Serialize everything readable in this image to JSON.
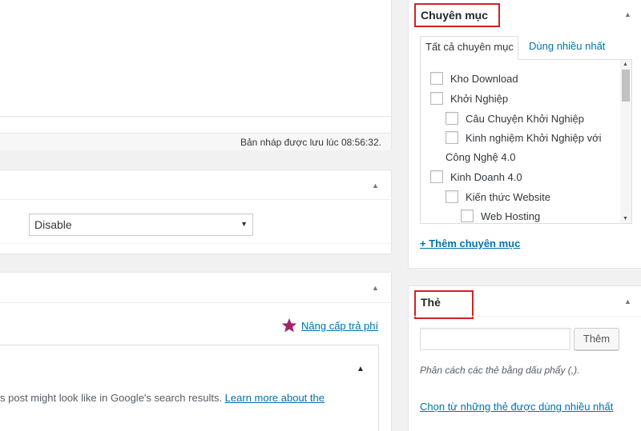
{
  "editor": {
    "status_text": "Bản nháp được lưu lúc 08:56:32."
  },
  "box2": {
    "select_value": "Disable"
  },
  "box3": {
    "upgrade_link": "Nâng cấp trả phí",
    "seo_text": "s post might look like in Google's search results. ",
    "seo_link": "Learn more about the"
  },
  "categories": {
    "title": "Chuyên mục",
    "tabs": [
      "Tất cả chuyên mục",
      "Dùng nhiều nhất"
    ],
    "items": [
      "Kho Download",
      "Khởi Nghiệp",
      "Câu Chuyện Khởi Nghiệp",
      "Kinh nghiệm Khởi Nghiệp với",
      "Công Nghệ 4.0",
      "Kinh Doanh 4.0",
      "Kiến thức Website",
      "Web Hosting"
    ],
    "add_link": "+ Thêm chuyên mục"
  },
  "tags": {
    "title": "Thẻ",
    "add_button": "Thêm",
    "hint": "Phân cách các thẻ bằng dấu phẩy (,).",
    "choose_link": "Chọn từ những thẻ được dùng nhiều nhất"
  },
  "icons": {
    "collapse": "triangle-up-icon",
    "dropdown": "triangle-down-icon",
    "upgrade": "star-icon"
  },
  "colors": {
    "link": "#0073aa",
    "highlight": "#d32026",
    "star": "#a0266a"
  }
}
